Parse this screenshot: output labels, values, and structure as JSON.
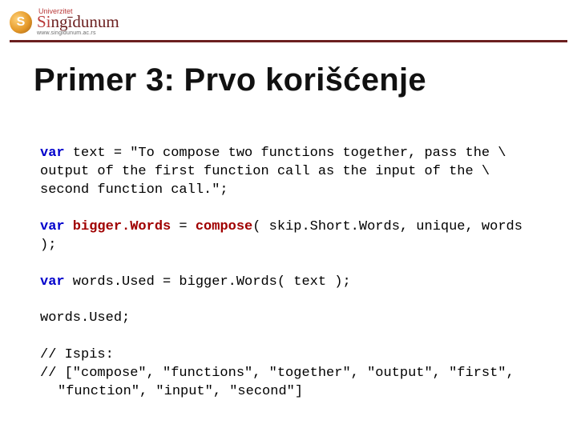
{
  "logo": {
    "initial": "S",
    "wordmark_prefix": "Si",
    "wordmark_rest": "ngīdunum",
    "universitet": "Univerzitet",
    "url": "www.singidunum.ac.rs"
  },
  "title": "Primer 3: Prvo korišćenje",
  "code": {
    "kw_var": "var",
    "l1_a": " text = \"To compose two functions together, pass the \\",
    "l2": "output of the first function call as the input of the \\",
    "l3": "second function call.\";",
    "l5_b": " bigger.Words",
    "l5_c": " = ",
    "l5_d": "compose",
    "l5_e": "( skip.Short.Words, unique, words );",
    "l7_b": " words.Used = bigger.Words( text );",
    "l9": "words.Used;",
    "l11": "// Ispis:",
    "l12": "// [\"compose\", \"functions\", \"together\", \"output\", \"first\",",
    "l13": "\"function\", \"input\", \"second\"]"
  }
}
